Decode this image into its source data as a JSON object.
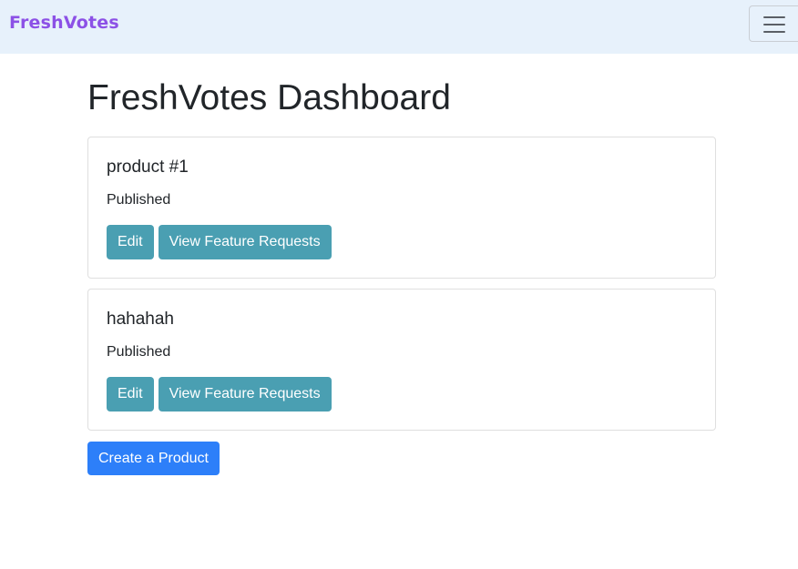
{
  "navbar": {
    "brand": "FreshVotes",
    "brand_color": "#8c51e6",
    "background": "#e7f1fb",
    "toggler_icon": "hamburger-menu-icon"
  },
  "main": {
    "title": "FreshVotes Dashboard",
    "products": [
      {
        "name": "product #1",
        "status": "Published",
        "edit_label": "Edit",
        "view_requests_label": "View Feature Requests"
      },
      {
        "name": "hahahah",
        "status": "Published",
        "edit_label": "Edit",
        "view_requests_label": "View Feature Requests"
      }
    ],
    "create_label": "Create a Product"
  },
  "colors": {
    "info_button": "#4a9fb2",
    "primary_button": "#2d7ff9"
  }
}
